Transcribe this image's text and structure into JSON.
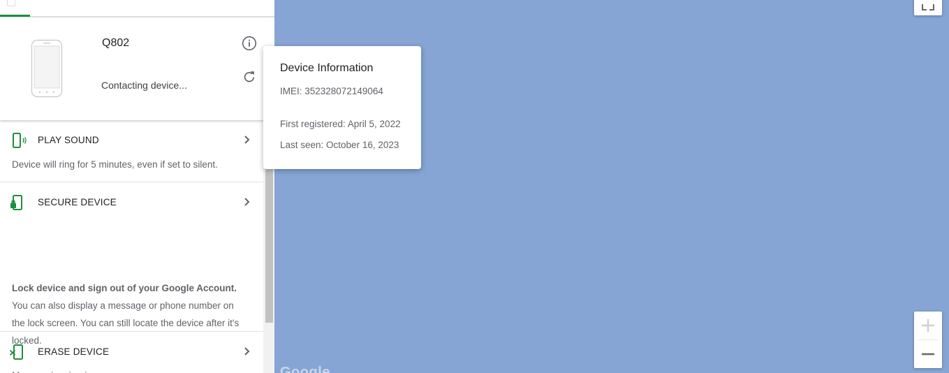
{
  "device": {
    "name": "Q802",
    "status": "Contacting device..."
  },
  "actions": [
    {
      "title": "PLAY SOUND",
      "description": "Device will ring for 5 minutes, even if set to silent.",
      "icon": "phone-ring-icon"
    },
    {
      "title": "SECURE DEVICE",
      "description_bold": "Lock device and sign out of your Google Account.",
      "description": "You can also display a message or phone number on the lock screen. You can still locate the device after it's locked.",
      "note": "May require sign-in.",
      "icon": "phone-lock-icon"
    },
    {
      "title": "ERASE DEVICE",
      "icon": "phone-erase-icon"
    }
  ],
  "popup": {
    "title": "Device Information",
    "imei": "IMEI: 352328072149064",
    "first_registered": "First registered: April 5, 2022",
    "last_seen": "Last seen: October 16, 2023"
  },
  "map": {
    "attribution": "Google",
    "zoom_in": "+",
    "zoom_out": "−"
  },
  "colors": {
    "accent": "#1e8e3e",
    "map_water": "#86a5d5",
    "text_secondary": "#5f6368"
  }
}
